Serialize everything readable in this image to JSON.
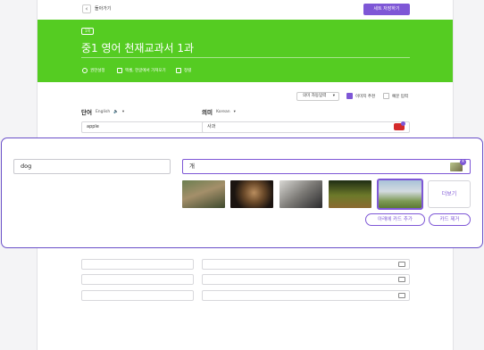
{
  "topbar": {
    "back_icon": "chevron-left",
    "back_label": "돌아가기",
    "save_label": "세트 저장하기"
  },
  "header": {
    "badge": "1학",
    "title": "중1 영어 천재교과서 1과",
    "options": [
      {
        "icon": "gear-icon",
        "label": "권한설정"
      },
      {
        "icon": "sheet-icon",
        "label": "엑셀, 한글에서 가져오기"
      },
      {
        "icon": "list-icon",
        "label": "정렬"
      }
    ]
  },
  "toolbar": {
    "auto_input": "의미 자동입력",
    "checkbox_image": "이미지 추천",
    "checkbox_example": "예문 입력"
  },
  "columns": {
    "word": {
      "title": "단어",
      "lang": "English"
    },
    "meaning": {
      "title": "의미",
      "lang": "Korean"
    }
  },
  "first_card": {
    "word": "apple",
    "meaning": "사과"
  },
  "active_card": {
    "word": "dog",
    "meaning": "개",
    "more_label": "더보기",
    "add_below_label": "아래에 카드 추가",
    "remove_label": "카드 제거"
  },
  "colors": {
    "accent": "#7e57d6",
    "header_green": "#55cc22"
  }
}
